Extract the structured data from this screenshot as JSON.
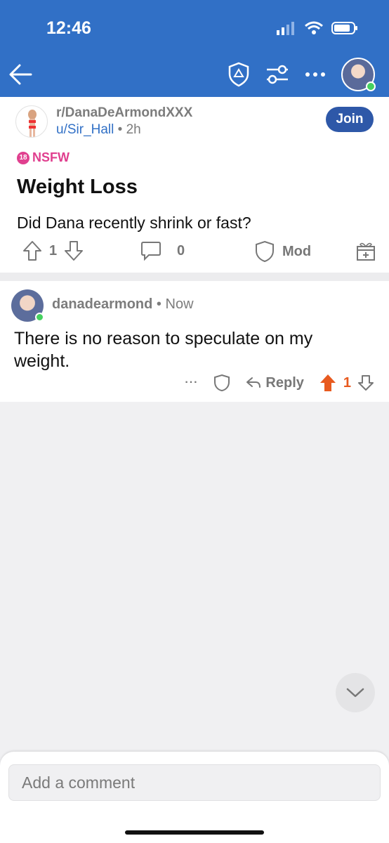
{
  "status": {
    "time": "12:46"
  },
  "post": {
    "subreddit": "r/DanaDeArmondXXX",
    "author": "u/Sir_Hall",
    "separator": "•",
    "age": "2h",
    "join_label": "Join",
    "nsfw_label": "NSFW",
    "nsfw_badge": "18",
    "title": "Weight Loss",
    "body": "Did Dana recently shrink or fast?",
    "upvotes": "1",
    "comments": "0",
    "mod_label": "Mod"
  },
  "comment": {
    "author": "danadearmond",
    "separator": "•",
    "age": "Now",
    "body": "There is no reason to speculate on my weight.",
    "more_label": "···",
    "reply_label": "Reply",
    "votes": "1"
  },
  "composer": {
    "placeholder": "Add a comment"
  },
  "colors": {
    "header": "#3170c6",
    "join": "#2e58a8",
    "nsfw": "#e0408f",
    "upvote_active": "#e85a1f",
    "online": "#46d160"
  },
  "icons": [
    "back-arrow-icon",
    "shield-icon",
    "filter-icon",
    "more-icon",
    "upvote-icon",
    "downvote-icon",
    "comment-icon",
    "gift-icon",
    "reply-icon",
    "chevron-down-icon"
  ]
}
